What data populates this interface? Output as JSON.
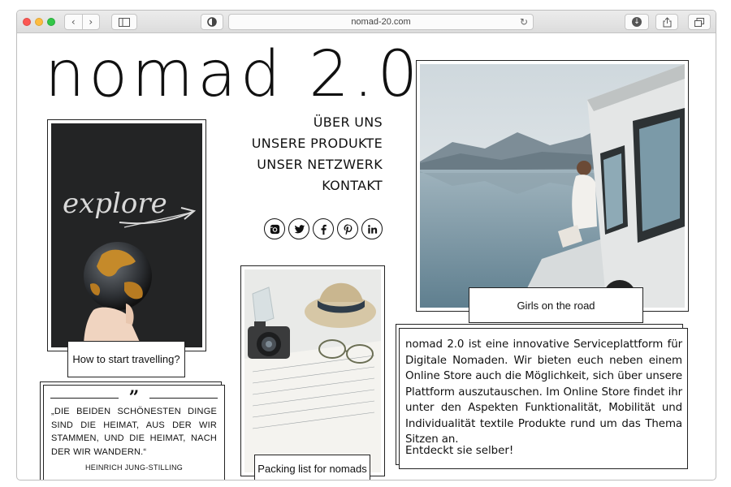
{
  "browser": {
    "url": "nomad-20.com"
  },
  "site": {
    "logo": "nomad 2.0",
    "nav": [
      {
        "label": "ÜBER UNS"
      },
      {
        "label": "UNSERE PRODUKTE"
      },
      {
        "label": "UNSER NETZWERK"
      },
      {
        "label": "KONTAKT"
      }
    ],
    "social_icons": [
      "instagram-icon",
      "twitter-icon",
      "facebook-icon",
      "pinterest-icon",
      "linkedin-icon"
    ]
  },
  "cards": {
    "explore": {
      "caption": "How to start travelling?",
      "chalk_text": "explore"
    },
    "road": {
      "caption": "Girls on the road"
    },
    "packing": {
      "caption": "Packing list for nomads"
    }
  },
  "quote": {
    "mark": "”",
    "text": "„Die beiden schönesten Dinge sind die Heimat, aus der wir stammen, und die Heimat, nach der wir wandern.“",
    "author": "Heinrich Jung-Stilling"
  },
  "description": {
    "text": "nomad 2.0 ist eine innovative Serviceplattform für Digitale Nomaden. Wir bieten euch neben einem Online Store auch die Möglichkeit, sich über unsere Plattform auszutauschen. Im Online Store findet ihr unter den Aspekten Funktionalität, Mobilität und Individualität textile Produkte rund um das Thema Sitzen an.",
    "cta": "Entdeckt sie selber!"
  }
}
